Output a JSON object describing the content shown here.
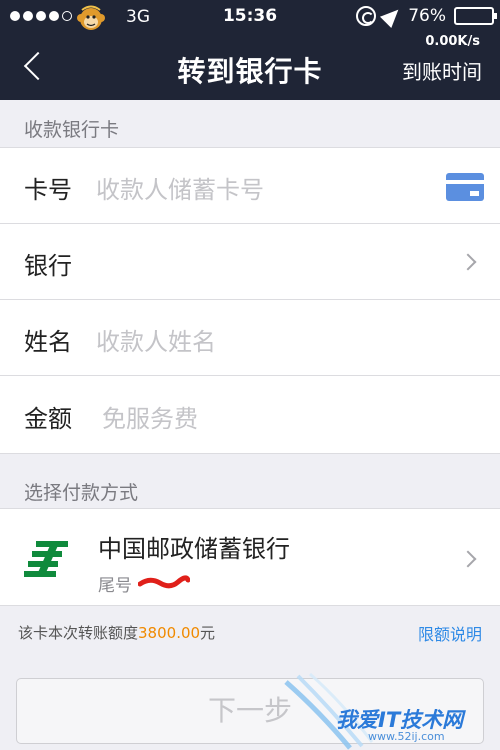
{
  "status_bar": {
    "carrier": "3G",
    "time": "15:36",
    "battery": "76%",
    "battery_level": 0.76
  },
  "nav": {
    "title": "转到银行卡",
    "speed": "0.00K/s",
    "right_action": "到账时间"
  },
  "receiver": {
    "section_label": "收款银行卡",
    "rows": [
      {
        "label": "卡号",
        "placeholder": "收款人储蓄卡号"
      },
      {
        "label": "银行"
      },
      {
        "label": "姓名",
        "placeholder": "收款人姓名"
      },
      {
        "label": "金额",
        "placeholder": "免服务费"
      }
    ]
  },
  "payment": {
    "section_label": "选择付款方式",
    "bank_name": "中国邮政储蓄银行",
    "tail_label": "尾号"
  },
  "limit": {
    "prefix": "该卡本次转账额度",
    "amount": "3800.00",
    "suffix": "元",
    "link": "限额说明"
  },
  "next_button": "下一步",
  "watermark": {
    "text": "我爱IT技术网",
    "url": "www.52ij.com"
  },
  "colors": {
    "nav_bg": "#1f2536",
    "accent_link": "#2f8ae6",
    "amount": "#f08a00",
    "bank_logo": "#0f8a3c"
  }
}
